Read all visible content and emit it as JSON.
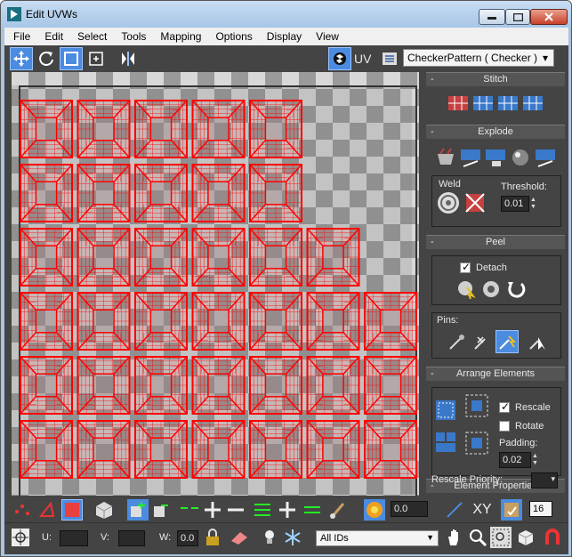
{
  "window": {
    "title": "Edit UVWs"
  },
  "menu": [
    "File",
    "Edit",
    "Select",
    "Tools",
    "Mapping",
    "Options",
    "Display",
    "View"
  ],
  "toolbar": {
    "uv_label": "UV",
    "texture_select": "CheckerPattern  ( Checker )"
  },
  "viewport": {
    "uv_grid": {
      "rows": 6,
      "columns": 7,
      "cells_per_row": [
        5,
        5,
        6,
        7,
        7,
        7
      ]
    },
    "colors": {
      "uv_edges": "#ff0000",
      "checker_dark": "#9a9a9a",
      "checker_light": "#d8d8d8"
    }
  },
  "panel": {
    "stitch": {
      "title": "Stitch"
    },
    "explode": {
      "title": "Explode",
      "weld_label": "Weld",
      "threshold_label": "Threshold:",
      "threshold_value": "0.01"
    },
    "peel": {
      "title": "Peel",
      "detach_label": "Detach",
      "detach_checked": true,
      "pins_label": "Pins:"
    },
    "arrange": {
      "title": "Arrange Elements",
      "rescale_label": "Rescale",
      "rescale_checked": true,
      "rotate_label": "Rotate",
      "rotate_checked": false,
      "padding_label": "Padding:",
      "padding_value": "0.02"
    },
    "element_properties": {
      "title": "Element Properties",
      "rescale_priority_label": "Rescale Priority:"
    }
  },
  "bottom": {
    "soft_select_value": "0.0",
    "xy_label": "XY",
    "grid_value": "16",
    "u_label": "U:",
    "v_label": "V:",
    "w_label": "W:",
    "w_value": "0.0",
    "ids_select": "All IDs"
  },
  "accent_color": "#4b8be0"
}
